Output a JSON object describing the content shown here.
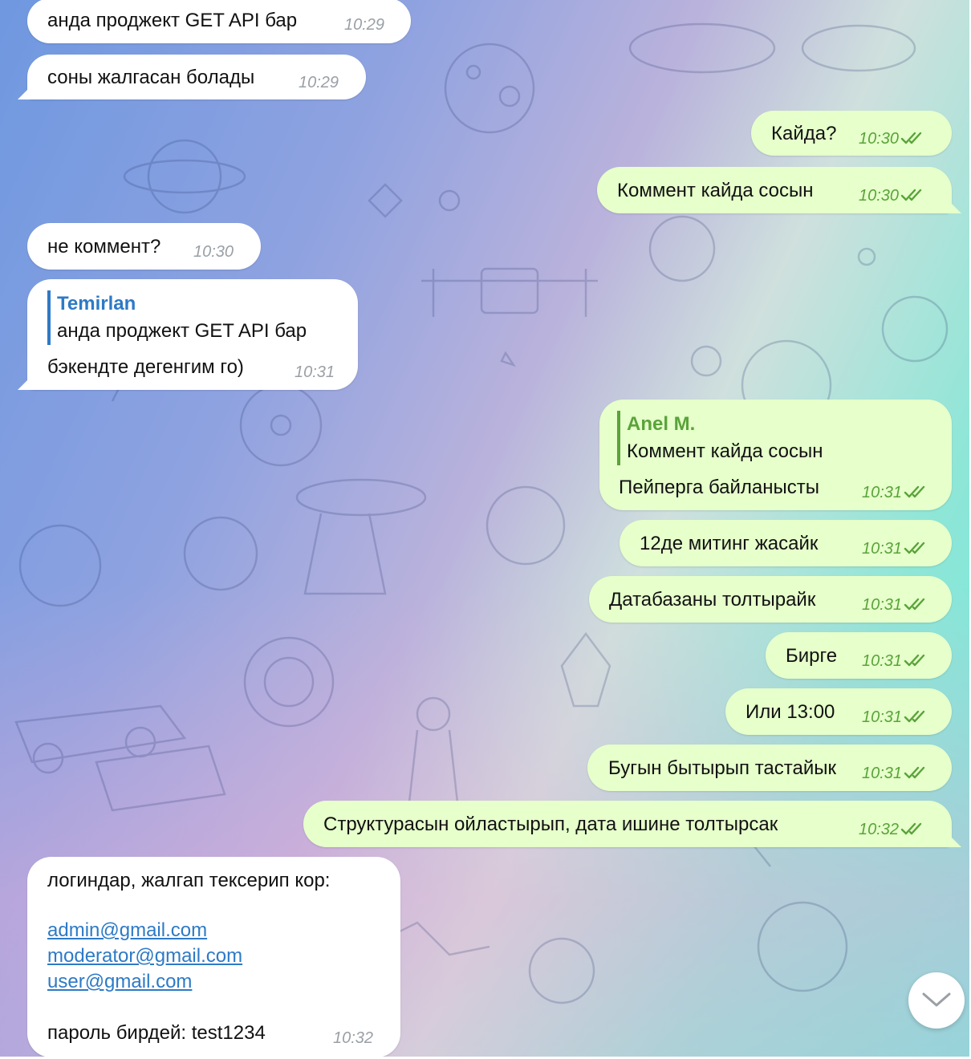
{
  "messages": {
    "m1": {
      "text": "анда проджект GET API бар",
      "time": "10:29"
    },
    "m2": {
      "text": "соны жалгасан болады",
      "time": "10:29"
    },
    "m3": {
      "text": "Кайда?",
      "time": "10:30"
    },
    "m4": {
      "text": "Коммент кайда сосын",
      "time": "10:30"
    },
    "m5": {
      "text": "не коммент?",
      "time": "10:30"
    },
    "m6": {
      "reply_name": "Temirlan",
      "reply_text": "анда проджект GET API бар",
      "text": "бэкендте дегенгим го)",
      "time": "10:31"
    },
    "m7": {
      "reply_name": "Anel M.",
      "reply_text": "Коммент кайда сосын",
      "text": "Пейперга байланысты",
      "time": "10:31"
    },
    "m8": {
      "text": "12де митинг жасайк",
      "time": "10:31"
    },
    "m9": {
      "text": "Датабазаны толтырайк",
      "time": "10:31"
    },
    "m10": {
      "text": "Бирге",
      "time": "10:31"
    },
    "m11": {
      "text": "Или 13:00",
      "time": "10:31"
    },
    "m12": {
      "text": "Бугын бытырып тастайык",
      "time": "10:31"
    },
    "m13": {
      "text": "Структурасын ойластырып, дата ишине толтырсак",
      "time": "10:32"
    },
    "m14": {
      "intro": "логиндар, жалгап тексерип кор:",
      "links": [
        "admin@gmail.com",
        "moderator@gmail.com",
        "user@gmail.com"
      ],
      "footer": "пароль бирдей: test1234",
      "time": "10:32"
    }
  },
  "icons": {
    "read_status": "double-check-icon",
    "scroll_down": "chevron-down-icon"
  },
  "colors": {
    "incoming_bubble": "#ffffff",
    "outgoing_bubble": "#e6ffcb",
    "outgoing_time": "#5aa33a",
    "reply_incoming_accent": "#2d7ac6",
    "reply_outgoing_accent": "#5aa33a",
    "link": "#2d7ac6"
  }
}
